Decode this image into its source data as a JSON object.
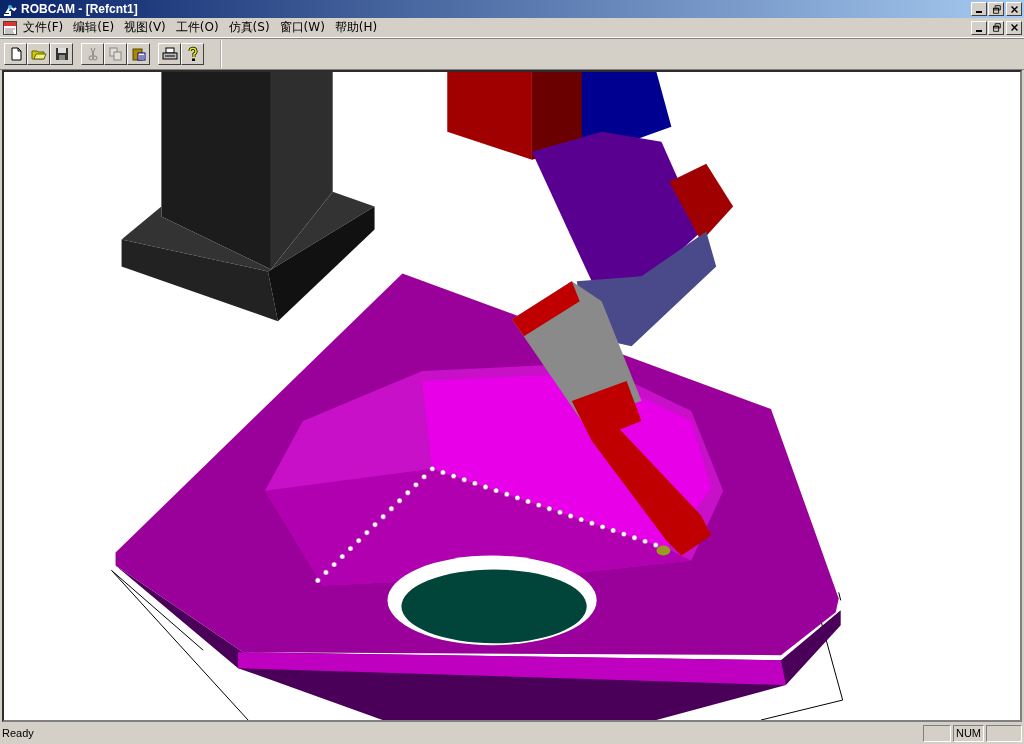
{
  "window": {
    "title": "ROBCAM - [Refcnt1]"
  },
  "menu": [
    {
      "label": "文件(F)"
    },
    {
      "label": "编辑(E)"
    },
    {
      "label": "视图(V)"
    },
    {
      "label": "工件(O)"
    },
    {
      "label": "仿真(S)"
    },
    {
      "label": "窗口(W)"
    },
    {
      "label": "帮助(H)"
    }
  ],
  "toolbar": [
    {
      "kind": "new",
      "disabled": false
    },
    {
      "kind": "open",
      "disabled": false
    },
    {
      "kind": "save",
      "disabled": false
    },
    {
      "kind": "sep"
    },
    {
      "kind": "cut",
      "disabled": true
    },
    {
      "kind": "copy",
      "disabled": true
    },
    {
      "kind": "paste",
      "disabled": false
    },
    {
      "kind": "sep"
    },
    {
      "kind": "print",
      "disabled": false
    },
    {
      "kind": "help",
      "disabled": false
    }
  ],
  "status_bar": {
    "message": "Ready",
    "panes": [
      {
        "kind": "blank"
      },
      {
        "kind": "indicator",
        "text": "NUM"
      },
      {
        "kind": "blank"
      }
    ]
  }
}
